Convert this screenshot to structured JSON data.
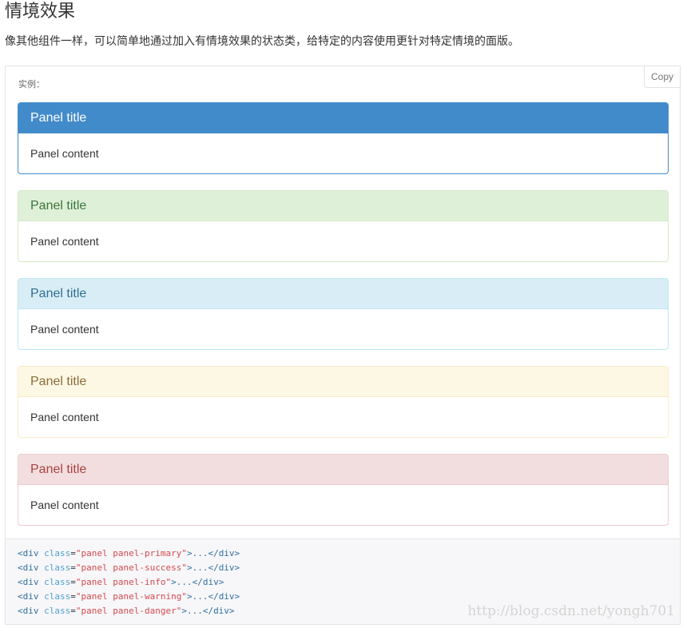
{
  "section": {
    "heading": "情境效果",
    "intro": "像其他组件一样，可以简单地通过加入有情境效果的状态类，给特定的内容使用更针对特定情境的面版。"
  },
  "example": {
    "label": "实例：",
    "copy_label": "Copy",
    "panels": [
      {
        "variant": "primary",
        "title": "Panel title",
        "content": "Panel content",
        "heading_bg": "#428bca",
        "heading_color": "#ffffff",
        "border": "#428bca",
        "heading_border": "#428bca"
      },
      {
        "variant": "success",
        "title": "Panel title",
        "content": "Panel content",
        "heading_bg": "#dff0d8",
        "heading_color": "#3c763d",
        "border": "#d6e9c6",
        "heading_border": "#d6e9c6"
      },
      {
        "variant": "info",
        "title": "Panel title",
        "content": "Panel content",
        "heading_bg": "#d9edf7",
        "heading_color": "#31708f",
        "border": "#bce8f1",
        "heading_border": "#bce8f1"
      },
      {
        "variant": "warning",
        "title": "Panel title",
        "content": "Panel content",
        "heading_bg": "#fcf8e3",
        "heading_color": "#8a6d3b",
        "border": "#faebcc",
        "heading_border": "#faebcc"
      },
      {
        "variant": "danger",
        "title": "Panel title",
        "content": "Panel content",
        "heading_bg": "#f2dede",
        "heading_color": "#a94442",
        "border": "#ebccd1",
        "heading_border": "#ebccd1"
      }
    ]
  },
  "code": {
    "tag_color": "#2f6f9f",
    "attr_color": "#4f9fcf",
    "string_color": "#d44950",
    "lines": [
      {
        "open": "<div",
        "attr": "class",
        "value": "\"panel panel-primary\"",
        "rest": ">...</div>"
      },
      {
        "open": "<div",
        "attr": "class",
        "value": "\"panel panel-success\"",
        "rest": ">...</div>"
      },
      {
        "open": "<div",
        "attr": "class",
        "value": "\"panel panel-info\"",
        "rest": ">...</div>"
      },
      {
        "open": "<div",
        "attr": "class",
        "value": "\"panel panel-warning\"",
        "rest": ">...</div>"
      },
      {
        "open": "<div",
        "attr": "class",
        "value": "\"panel panel-danger\"",
        "rest": ">...</div>"
      }
    ]
  },
  "watermark": "http://blog.csdn.net/yongh701"
}
